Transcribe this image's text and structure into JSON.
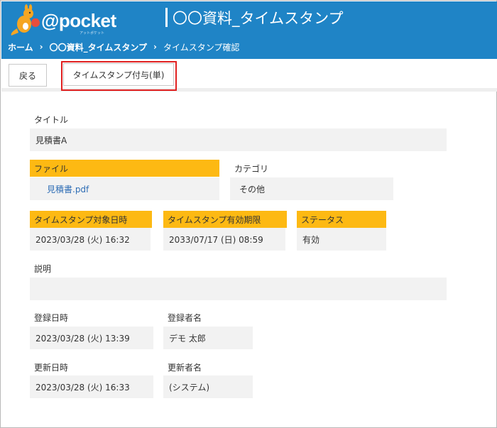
{
  "header": {
    "logo_text": "@pocket",
    "logo_sub": "アットポケット",
    "app_title": "〇〇資料_タイムスタンプ",
    "breadcrumb": {
      "home": "ホーム",
      "parent": "〇〇資料_タイムスタンプ",
      "current": "タイムスタンプ確認",
      "separator": "›"
    }
  },
  "toolbar": {
    "back_label": "戻る",
    "stamp_label": "タイムスタンプ付与(単)"
  },
  "form": {
    "title_label": "タイトル",
    "title_value": "見積書A",
    "file_label": "ファイル",
    "file_value": "見積書.pdf",
    "category_label": "カテゴリ",
    "category_value": "その他",
    "target_datetime_label": "タイムスタンプ対象日時",
    "target_datetime_value": "2023/03/28 (火) 16:32",
    "expiry_label": "タイムスタンプ有効期限",
    "expiry_value": "2033/07/17 (日) 08:59",
    "status_label": "ステータス",
    "status_value": "有効",
    "description_label": "説明",
    "description_value": "",
    "registered_at_label": "登録日時",
    "registered_at_value": "2023/03/28 (火) 13:39",
    "registered_by_label": "登録者名",
    "registered_by_value": "デモ 太郎",
    "updated_at_label": "更新日時",
    "updated_at_value": "2023/03/28 (火) 16:33",
    "updated_by_label": "更新者名",
    "updated_by_value": "(システム)"
  },
  "colors": {
    "header_blue": "#1f84c6",
    "label_yellow": "#fdb913",
    "value_gray": "#f2f2f2",
    "highlight_red": "#e02020",
    "link_blue": "#2e6db5"
  }
}
